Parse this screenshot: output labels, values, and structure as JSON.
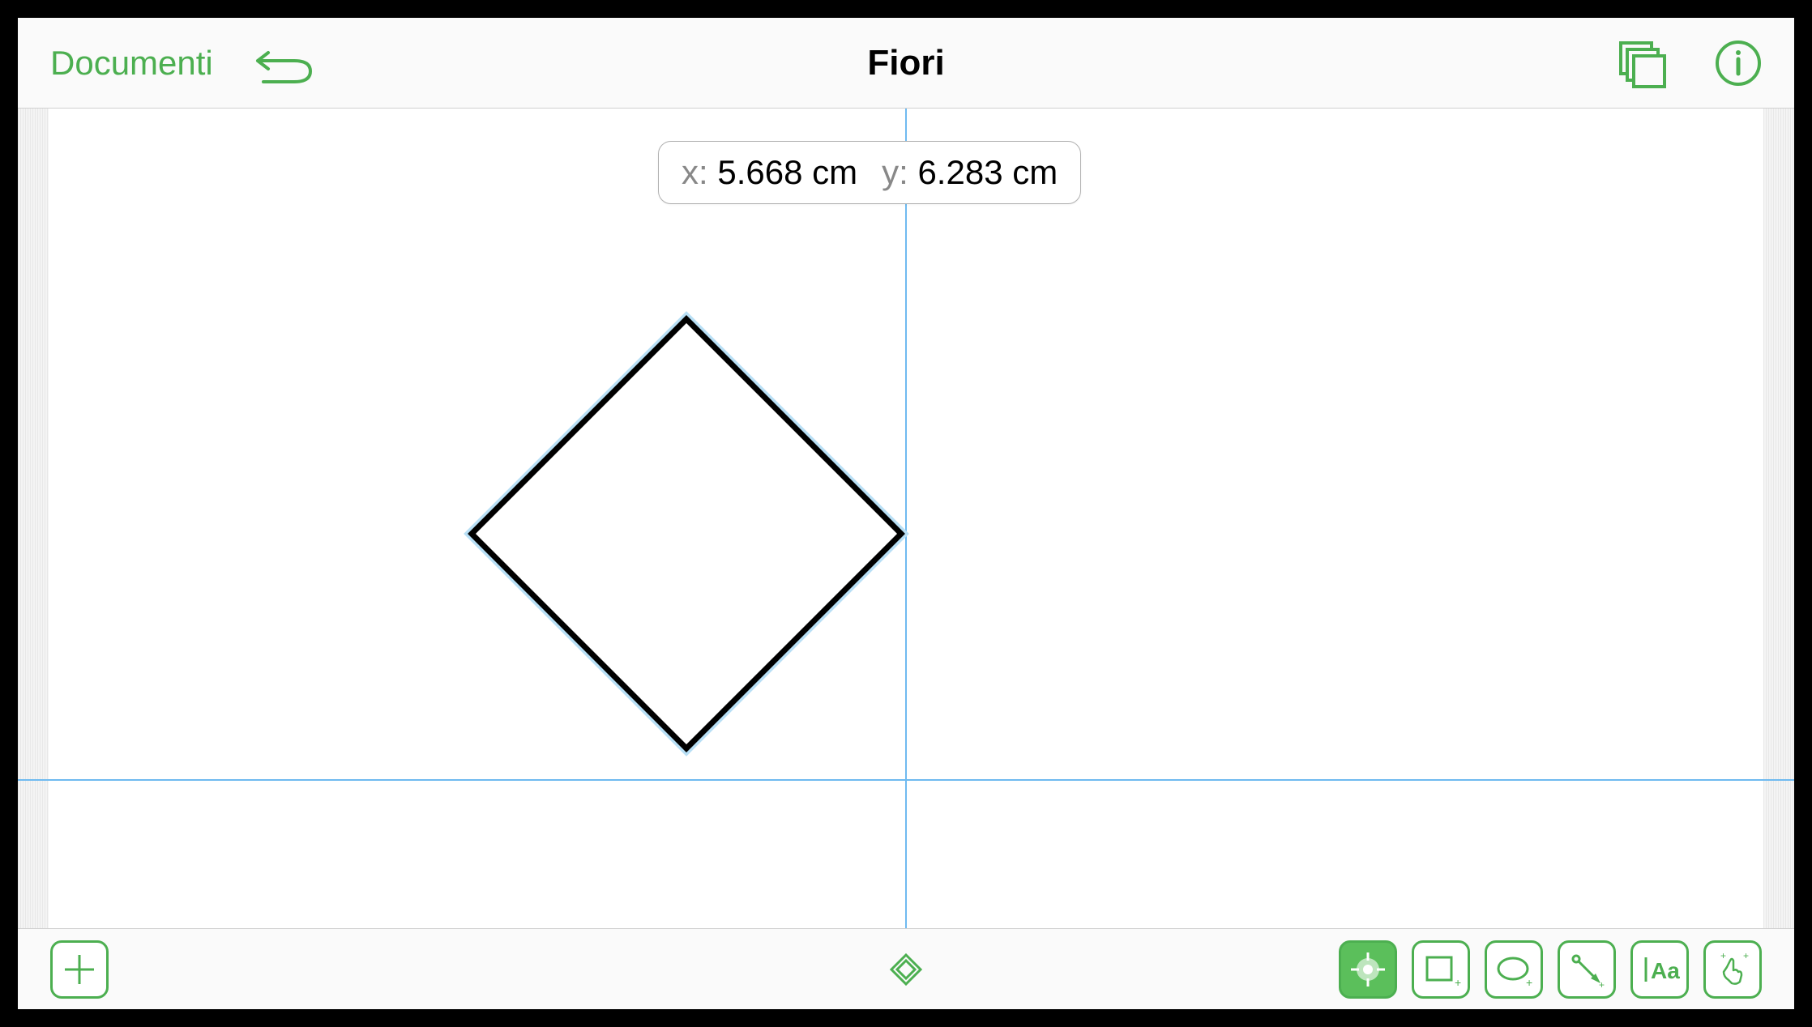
{
  "header": {
    "documents_label": "Documenti",
    "title": "Fiori"
  },
  "canvas": {
    "coords": {
      "x_label": "x:",
      "x_value": "5.668 cm",
      "y_label": "y:",
      "y_value": "6.283 cm"
    }
  },
  "colors": {
    "accent": "#4CAF50",
    "guide": "#6fbaf0"
  },
  "icons": {
    "undo": "undo-icon",
    "layers": "layers-icon",
    "info": "info-icon",
    "add": "add-icon",
    "diamond_indicator": "diamond-icon",
    "point": "point-tool-icon",
    "rectangle": "rectangle-tool-icon",
    "ellipse": "ellipse-tool-icon",
    "pen": "pen-tool-icon",
    "text": "text-tool-icon",
    "touch": "touch-tool-icon"
  },
  "tools": {
    "text_label": "Aa"
  }
}
